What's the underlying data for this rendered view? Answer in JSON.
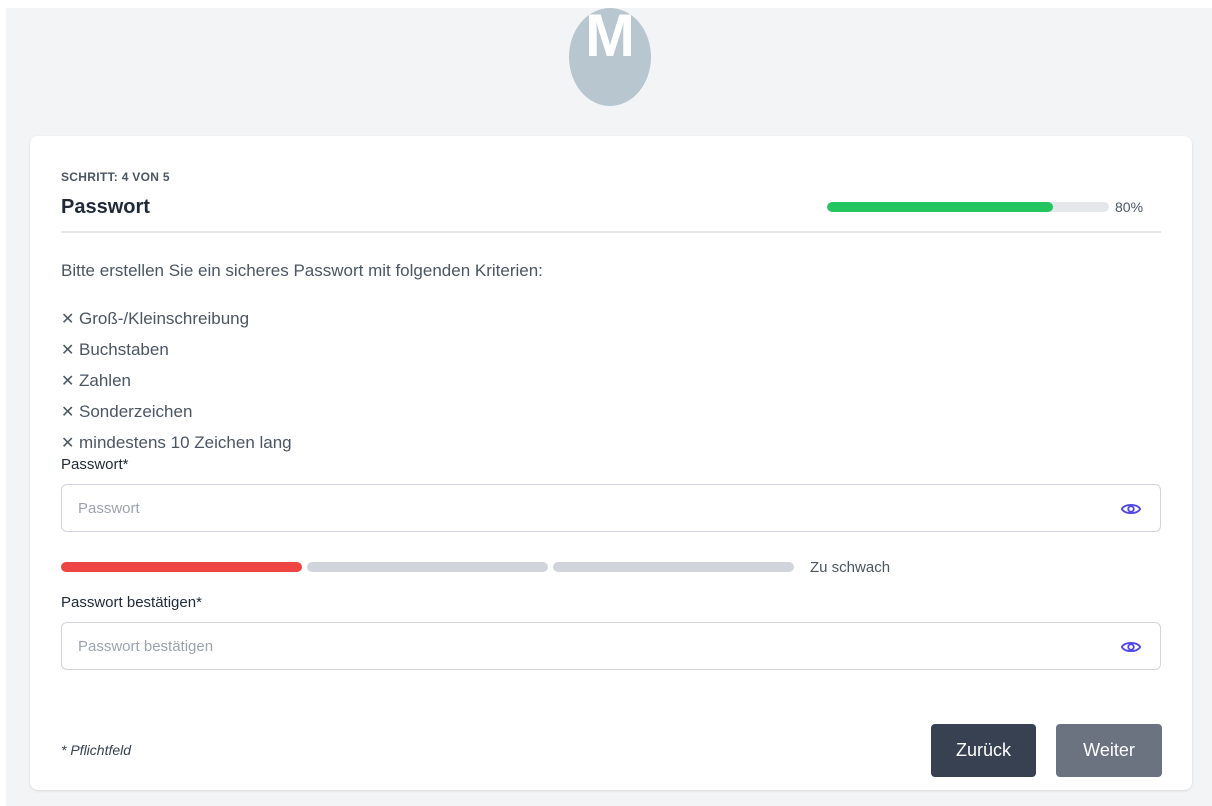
{
  "logo": {
    "letter": "M"
  },
  "step": {
    "label": "SCHRITT: 4 VON 5"
  },
  "title": "Passwort",
  "progress": {
    "percent": 80,
    "text": "80%"
  },
  "intro": "Bitte erstellen Sie ein sicheres Passwort mit folgenden Kriterien:",
  "criteria": [
    {
      "mark": "✕",
      "text": "Groß-/Kleinschreibung"
    },
    {
      "mark": "✕",
      "text": "Buchstaben"
    },
    {
      "mark": "✕",
      "text": "Zahlen"
    },
    {
      "mark": "✕",
      "text": "Sonderzeichen"
    },
    {
      "mark": "✕",
      "text": "mindestens 10 Zeichen lang"
    }
  ],
  "password": {
    "label": "Passwort*",
    "placeholder": "Passwort",
    "value": "",
    "icon": "eye-icon"
  },
  "strength": {
    "segments_total": 3,
    "segments_active": 1,
    "active_color": "#ef4444",
    "text": "Zu schwach"
  },
  "confirm": {
    "label": "Passwort bestätigen*",
    "placeholder": "Passwort bestätigen",
    "value": "",
    "icon": "eye-icon"
  },
  "footer": {
    "required_note": "* Pflichtfeld",
    "back_label": "Zurück",
    "next_label": "Weiter"
  },
  "colors": {
    "accent_icon": "#4f46e5",
    "progress": "#22c55e",
    "back_button": "#374151",
    "next_button": "#6b7280"
  }
}
